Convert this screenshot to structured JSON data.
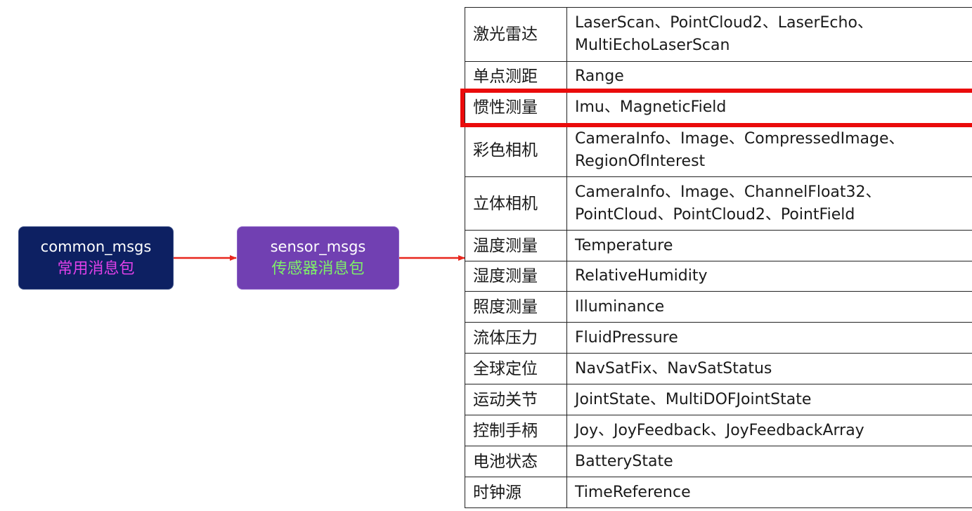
{
  "packages": {
    "common": {
      "name": "common_msgs",
      "desc": "常用消息包",
      "bg_color": "#0d2062",
      "desc_color": "#e040e8"
    },
    "sensor": {
      "name": "sensor_msgs",
      "desc": "传感器消息包",
      "bg_color": "#7140b2",
      "desc_color": "#7ef068"
    }
  },
  "arrow_color": "#e8271d",
  "highlight_color": "#ea0b0b",
  "highlighted_row": "惯性测量",
  "table": {
    "rows": [
      {
        "category": "激光雷达",
        "messages": "LaserScan、PointCloud2、LaserEcho、\nMultiEchoLaserScan"
      },
      {
        "category": "单点测距",
        "messages": "Range"
      },
      {
        "category": "惯性测量",
        "messages": "Imu、MagneticField"
      },
      {
        "category": "彩色相机",
        "messages": "CameraInfo、Image、CompressedImage、\nRegionOfInterest"
      },
      {
        "category": "立体相机",
        "messages": "CameraInfo、Image、ChannelFloat32、\nPointCloud、PointCloud2、PointField"
      },
      {
        "category": "温度测量",
        "messages": "Temperature"
      },
      {
        "category": "湿度测量",
        "messages": "RelativeHumidity"
      },
      {
        "category": "照度测量",
        "messages": "Illuminance"
      },
      {
        "category": "流体压力",
        "messages": "FluidPressure"
      },
      {
        "category": "全球定位",
        "messages": "NavSatFix、NavSatStatus"
      },
      {
        "category": "运动关节",
        "messages": "JointState、MultiDOFJointState"
      },
      {
        "category": "控制手柄",
        "messages": "Joy、JoyFeedback、JoyFeedbackArray"
      },
      {
        "category": "电池状态",
        "messages": "BatteryState"
      },
      {
        "category": "时钟源",
        "messages": "TimeReference"
      }
    ]
  }
}
